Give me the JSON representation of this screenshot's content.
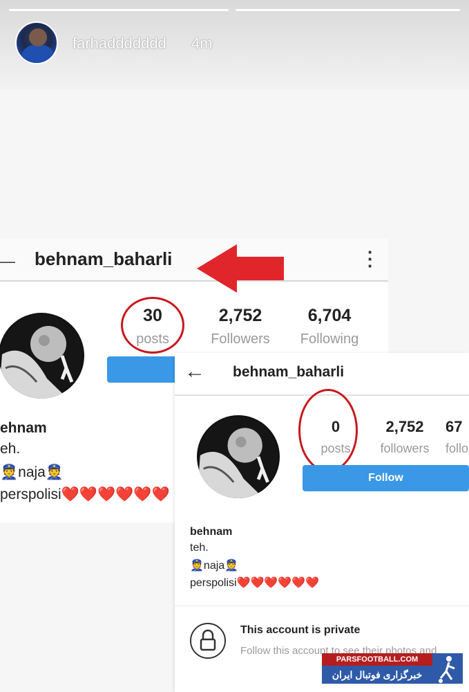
{
  "story": {
    "username": "farhaddddddd",
    "time": "4m"
  },
  "screenshot1": {
    "username": "behnam_baharli",
    "stats": [
      {
        "value": "30",
        "label": "posts"
      },
      {
        "value": "2,752",
        "label": "Followers"
      },
      {
        "value": "6,704",
        "label": "Following"
      }
    ],
    "bio": {
      "name": "ehnam",
      "line1": "eh.",
      "line2": "👮naja👮",
      "line3": "perspolisi❤️❤️❤️❤️❤️❤️"
    }
  },
  "screenshot2": {
    "username": "behnam_baharli",
    "stats": [
      {
        "value": "0",
        "label": "posts"
      },
      {
        "value": "2,752",
        "label": "followers"
      },
      {
        "value": "67",
        "label": "follo"
      }
    ],
    "follow_label": "Follow",
    "bio": {
      "name": "behnam",
      "line1": "teh.",
      "line2": "👮naja👮",
      "line3": "perspolisi❤️❤️❤️❤️❤️❤️"
    },
    "private_title": "This account is private",
    "private_sub": "Follow this account to see their photos and"
  },
  "watermark": {
    "top": "PARSFOOTBALL.COM",
    "bottom": "خبرگزاری فوتبال ایران"
  },
  "colors": {
    "accent_blue": "#3a98e6",
    "highlight_red": "#c8171e"
  }
}
